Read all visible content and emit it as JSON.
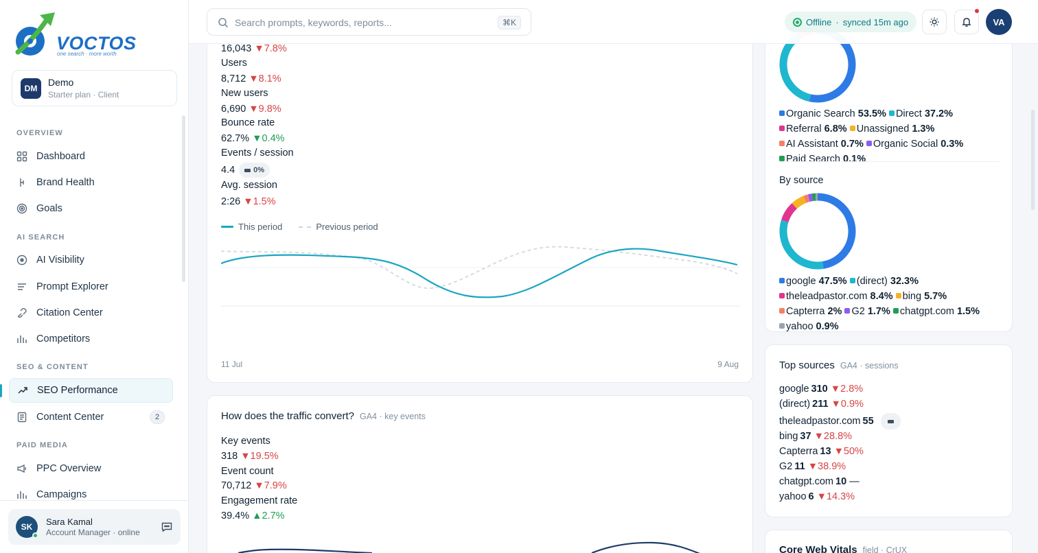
{
  "brand": {
    "name": "VOCTOS",
    "tagline": "one search · more worth"
  },
  "workspace": {
    "initials": "DM",
    "name": "Demo",
    "plan": "Starter plan · Client"
  },
  "nav": {
    "sections": [
      {
        "title": "OVERVIEW",
        "items": [
          {
            "label": "Dashboard",
            "icon": "grid-icon"
          },
          {
            "label": "Brand Health",
            "icon": "pulse-icon"
          },
          {
            "label": "Goals",
            "icon": "target-icon"
          }
        ]
      },
      {
        "title": "AI SEARCH",
        "items": [
          {
            "label": "AI Visibility",
            "icon": "radar-icon"
          },
          {
            "label": "Prompt Explorer",
            "icon": "list-icon"
          },
          {
            "label": "Citation Center",
            "icon": "link-icon"
          },
          {
            "label": "Competitors",
            "icon": "bar-chart-icon"
          }
        ]
      },
      {
        "title": "SEO & CONTENT",
        "items": [
          {
            "label": "SEO Performance",
            "icon": "trend-up-icon",
            "active": true
          },
          {
            "label": "Content Center",
            "icon": "document-icon",
            "badge": "2"
          }
        ]
      },
      {
        "title": "PAID MEDIA",
        "items": [
          {
            "label": "PPC Overview",
            "icon": "megaphone-icon"
          },
          {
            "label": "Campaigns",
            "icon": "bar-chart-icon"
          }
        ]
      }
    ]
  },
  "user": {
    "initials": "SK",
    "name": "Sara Kamal",
    "role": "Account Manager · online"
  },
  "topbar": {
    "search_placeholder": "Search prompts, keywords, reports...",
    "shortcut": "⌘K",
    "status_label": "Offline",
    "status_sep": "·",
    "status_sync": "synced 15m ago",
    "avatar_initials": "VA"
  },
  "traffic": {
    "metrics": [
      {
        "value": "16,043",
        "change": "▼7.8%",
        "trend": "down"
      },
      {
        "label": "Users",
        "value": "8,712",
        "change": "▼8.1%",
        "trend": "down"
      },
      {
        "label": "New users",
        "value": "6,690",
        "change": "▼9.8%",
        "trend": "down"
      },
      {
        "label": "Bounce rate",
        "value": "62.7%",
        "change": "▼0.4%",
        "trend": "up"
      },
      {
        "label": "Events / session",
        "value": "4.4",
        "change": "0%",
        "trend": "flat"
      },
      {
        "label": "Avg. session",
        "value": "2:26",
        "change": "▼1.5%",
        "trend": "down"
      }
    ],
    "legend": {
      "current": "This period",
      "previous": "Previous period"
    },
    "x_start": "11 Jul",
    "x_end": "9 Aug"
  },
  "convert": {
    "title": "How does the traffic convert?",
    "subtitle": "GA4 · key events",
    "metrics": [
      {
        "label": "Key events",
        "value": "318",
        "change": "▼19.5%",
        "trend": "down"
      },
      {
        "label": "Event count",
        "value": "70,712",
        "change": "▼7.9%",
        "trend": "down"
      },
      {
        "label": "Engagement rate",
        "value": "39.4%",
        "change": "▲2.7%",
        "trend": "up"
      }
    ]
  },
  "channels": {
    "by_channel": [
      {
        "name": "Organic Search",
        "pct": "53.5%",
        "value": 53.5,
        "color": "#2e7be6"
      },
      {
        "name": "Direct",
        "pct": "37.2%",
        "value": 37.2,
        "color": "#1fb6cf"
      },
      {
        "name": "Referral",
        "pct": "6.8%",
        "value": 6.8,
        "color": "#e0358f"
      },
      {
        "name": "Unassigned",
        "pct": "1.3%",
        "value": 1.3,
        "color": "#f5b323"
      },
      {
        "name": "AI Assistant",
        "pct": "0.7%",
        "value": 0.7,
        "color": "#f57f67"
      },
      {
        "name": "Organic Social",
        "pct": "0.3%",
        "value": 0.3,
        "color": "#8b5cf0"
      },
      {
        "name": "Paid Search",
        "pct": "0.1%",
        "value": 0.1,
        "color": "#1f9d55"
      }
    ],
    "by_source_title": "By source",
    "by_source": [
      {
        "name": "google",
        "pct": "47.5%",
        "value": 47.5,
        "color": "#2e7be6"
      },
      {
        "name": "(direct)",
        "pct": "32.3%",
        "value": 32.3,
        "color": "#1fb6cf"
      },
      {
        "name": "theleadpastor.com",
        "pct": "8.4%",
        "value": 8.4,
        "color": "#e0358f"
      },
      {
        "name": "bing",
        "pct": "5.7%",
        "value": 5.7,
        "color": "#f5b323"
      },
      {
        "name": "Capterra",
        "pct": "2%",
        "value": 2,
        "color": "#f57f67"
      },
      {
        "name": "G2",
        "pct": "1.7%",
        "value": 1.7,
        "color": "#8b5cf0"
      },
      {
        "name": "chatgpt.com",
        "pct": "1.5%",
        "value": 1.5,
        "color": "#1f9d55"
      },
      {
        "name": "yahoo",
        "pct": "0.9%",
        "value": 0.9,
        "color": "#9aa3ad"
      }
    ]
  },
  "top_sources": {
    "title": "Top sources",
    "subtitle": "GA4 · sessions",
    "rows": [
      {
        "name": "google",
        "value": "310",
        "change": "▼2.8%",
        "trend": "down"
      },
      {
        "name": "(direct)",
        "value": "211",
        "change": "▼0.9%",
        "trend": "down"
      },
      {
        "name": "theleadpastor.com",
        "value": "55",
        "change": "",
        "trend": "flat"
      },
      {
        "name": "bing",
        "value": "37",
        "change": "▼28.8%",
        "trend": "down"
      },
      {
        "name": "Capterra",
        "value": "13",
        "change": "▼50%",
        "trend": "down"
      },
      {
        "name": "G2",
        "value": "11",
        "change": "▼38.9%",
        "trend": "down"
      },
      {
        "name": "chatgpt.com",
        "value": "10",
        "change": "—",
        "trend": "none"
      },
      {
        "name": "yahoo",
        "value": "6",
        "change": "▼14.3%",
        "trend": "down"
      }
    ]
  },
  "cwv": {
    "title": "Core Web Vitals",
    "subtitle": "field · CrUX"
  }
}
